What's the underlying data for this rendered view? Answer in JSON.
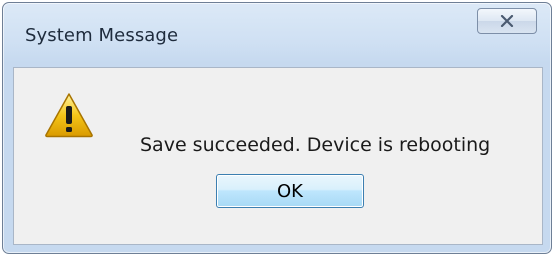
{
  "window": {
    "title": "System Message"
  },
  "icons": {
    "close": "close-icon",
    "warning": "warning-icon"
  },
  "dialog": {
    "message": "Save succeeded. Device is rebooting",
    "ok_label": "OK"
  },
  "colors": {
    "titlebar": "#cfe0f3",
    "client": "#f0f0f0",
    "ok_border": "#3c7fb1",
    "warning_fill": "#f5c518"
  }
}
